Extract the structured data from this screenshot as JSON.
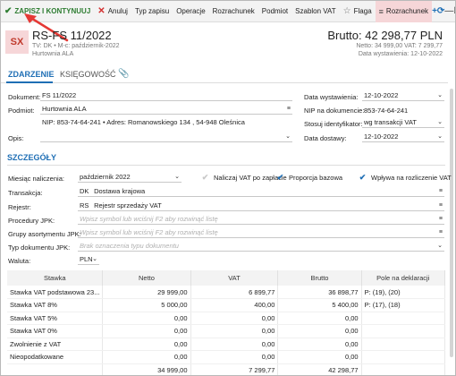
{
  "toolbar": {
    "save_label": "ZAPISZ I KONTYNUUJ",
    "cancel_label": "Anuluj",
    "items": [
      "Typ zapisu",
      "Operacje",
      "Rozrachunek",
      "Podmiot",
      "Szablon VAT"
    ],
    "flag_label": "Flaga",
    "active_label": "Rozrachunek"
  },
  "header": {
    "avatar": "SX",
    "title": "RS-FS 11/2022",
    "subtitle": "TV: DK  •  M-c: październik-2022",
    "company": "Hurtownia ALA",
    "brutto": "Brutto: 42 298,77 PLN",
    "netto_vat": "Netto: 34 999,00 VAT: 7 299,77",
    "issue_date": "Data wystawienia: 12-10-2022"
  },
  "tabs": [
    "ZDARZENIE",
    "KSIĘGOWOŚĆ"
  ],
  "form": {
    "dokument_label": "Dokument:",
    "dokument_value": "FS 11/2022",
    "podmiot_label": "Podmiot:",
    "podmiot_value": "Hurtownia ALA",
    "podmiot_details": "NIP: 853-74-64-241  •  Adres: Romanowskiego 134 , 54-948 Oleśnica",
    "opis_label": "Opis:",
    "data_wyst_label": "Data wystawienia:",
    "data_wyst_value": "12-10-2022",
    "nip_dok_label": "NIP na dokumencie:",
    "nip_dok_value": "853-74-64-241",
    "stosuj_label": "Stosuj identyfikator:",
    "stosuj_value": "wg transakcji VAT",
    "data_dost_label": "Data dostawy:",
    "data_dost_value": "12-10-2022"
  },
  "details": {
    "section_title": "SZCZEGÓŁY",
    "miesiac_label": "Miesiąc naliczenia:",
    "miesiac_value": "październik 2022",
    "cb_vat_po_zaplacie": "Naliczaj VAT po zapłacie",
    "cb_proporcja": "Proporcja bazowa",
    "cb_wplywa": "Wpływa na rozliczenie VAT",
    "transakcja_label": "Transakcja:",
    "transakcja_code": "DK",
    "transakcja_value": "Dostawa krajowa",
    "rejestr_label": "Rejestr:",
    "rejestr_code": "RS",
    "rejestr_value": "Rejestr sprzedaży VAT",
    "procedury_label": "Procedury JPK:",
    "procedury_ph": "Wpisz symbol lub wciśnij F2 aby rozwinąć listę",
    "grupy_label": "Grupy asortymentu JPK:",
    "grupy_ph": "Wpisz symbol lub wciśnij F2 aby rozwinąć listę",
    "typ_dok_label": "Typ dokumentu JPK:",
    "typ_dok_ph": "Brak oznaczenia typu dokumentu",
    "waluta_label": "Waluta:",
    "waluta_value": "PLN"
  },
  "table": {
    "headers": [
      "Stawka",
      "Netto",
      "VAT",
      "Brutto",
      "Pole na deklaracji"
    ],
    "rows": [
      [
        "Stawka VAT podstawowa 23...",
        "29 999,00",
        "6 899,77",
        "36 898,77",
        "P: (19), (20)"
      ],
      [
        "Stawka VAT 8%",
        "5 000,00",
        "400,00",
        "5 400,00",
        "P: (17), (18)"
      ],
      [
        "Stawka VAT 5%",
        "0,00",
        "0,00",
        "0,00",
        ""
      ],
      [
        "Stawka VAT 0%",
        "0,00",
        "0,00",
        "0,00",
        ""
      ],
      [
        "Zwolnienie z VAT",
        "0,00",
        "0,00",
        "0,00",
        ""
      ],
      [
        "Nieopodatkowane",
        "0,00",
        "0,00",
        "0,00",
        ""
      ]
    ],
    "totals": [
      "",
      "34 999,00",
      "7 299,77",
      "42 298,77",
      ""
    ]
  },
  "colors": {
    "accent": "#1f6fb5",
    "save": "#2e7d32",
    "active_bg": "#f6d6d8",
    "annotation": "#e53935"
  }
}
